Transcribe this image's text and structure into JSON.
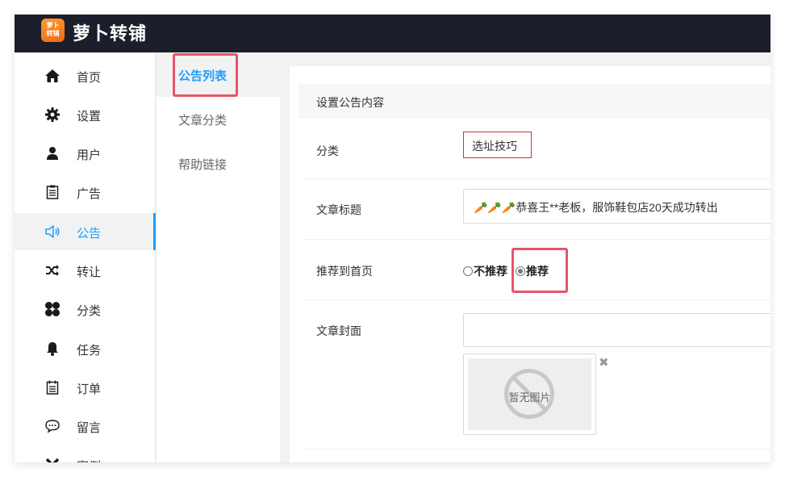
{
  "app": {
    "title": "萝卜转铺",
    "logo_line1": "萝卜",
    "logo_line2": "转铺"
  },
  "sidebar": {
    "items": [
      {
        "label": "首页",
        "icon": "home-icon"
      },
      {
        "label": "设置",
        "icon": "gear-icon"
      },
      {
        "label": "用户",
        "icon": "user-icon"
      },
      {
        "label": "广告",
        "icon": "clipboard-icon"
      },
      {
        "label": "公告",
        "icon": "speaker-icon",
        "active": true
      },
      {
        "label": "转让",
        "icon": "shuffle-icon"
      },
      {
        "label": "分类",
        "icon": "clover-icon"
      },
      {
        "label": "任务",
        "icon": "bell-icon"
      },
      {
        "label": "订单",
        "icon": "calendar-icon"
      },
      {
        "label": "留言",
        "icon": "chat-bubble-icon"
      },
      {
        "label": "案例",
        "icon": "x-icon"
      }
    ]
  },
  "subnav": {
    "items": [
      {
        "label": "公告列表",
        "active": true
      },
      {
        "label": "文章分类"
      },
      {
        "label": "帮助链接"
      }
    ]
  },
  "form": {
    "section_title": "设置公告内容",
    "category": {
      "label": "分类",
      "value": "选址技巧"
    },
    "title": {
      "label": "文章标题",
      "value": "🥕🥕🥕恭喜王**老板，服饰鞋包店20天成功转出"
    },
    "recommend": {
      "label": "推荐到首页",
      "option_no": "不推荐",
      "option_yes": "推荐",
      "selected": "推荐"
    },
    "cover": {
      "label": "文章封面",
      "placeholder_text": "暂无图片"
    }
  },
  "colors": {
    "accent": "#1e9fff",
    "highlight": "#e8546b",
    "topbar": "#1a1f2b"
  }
}
